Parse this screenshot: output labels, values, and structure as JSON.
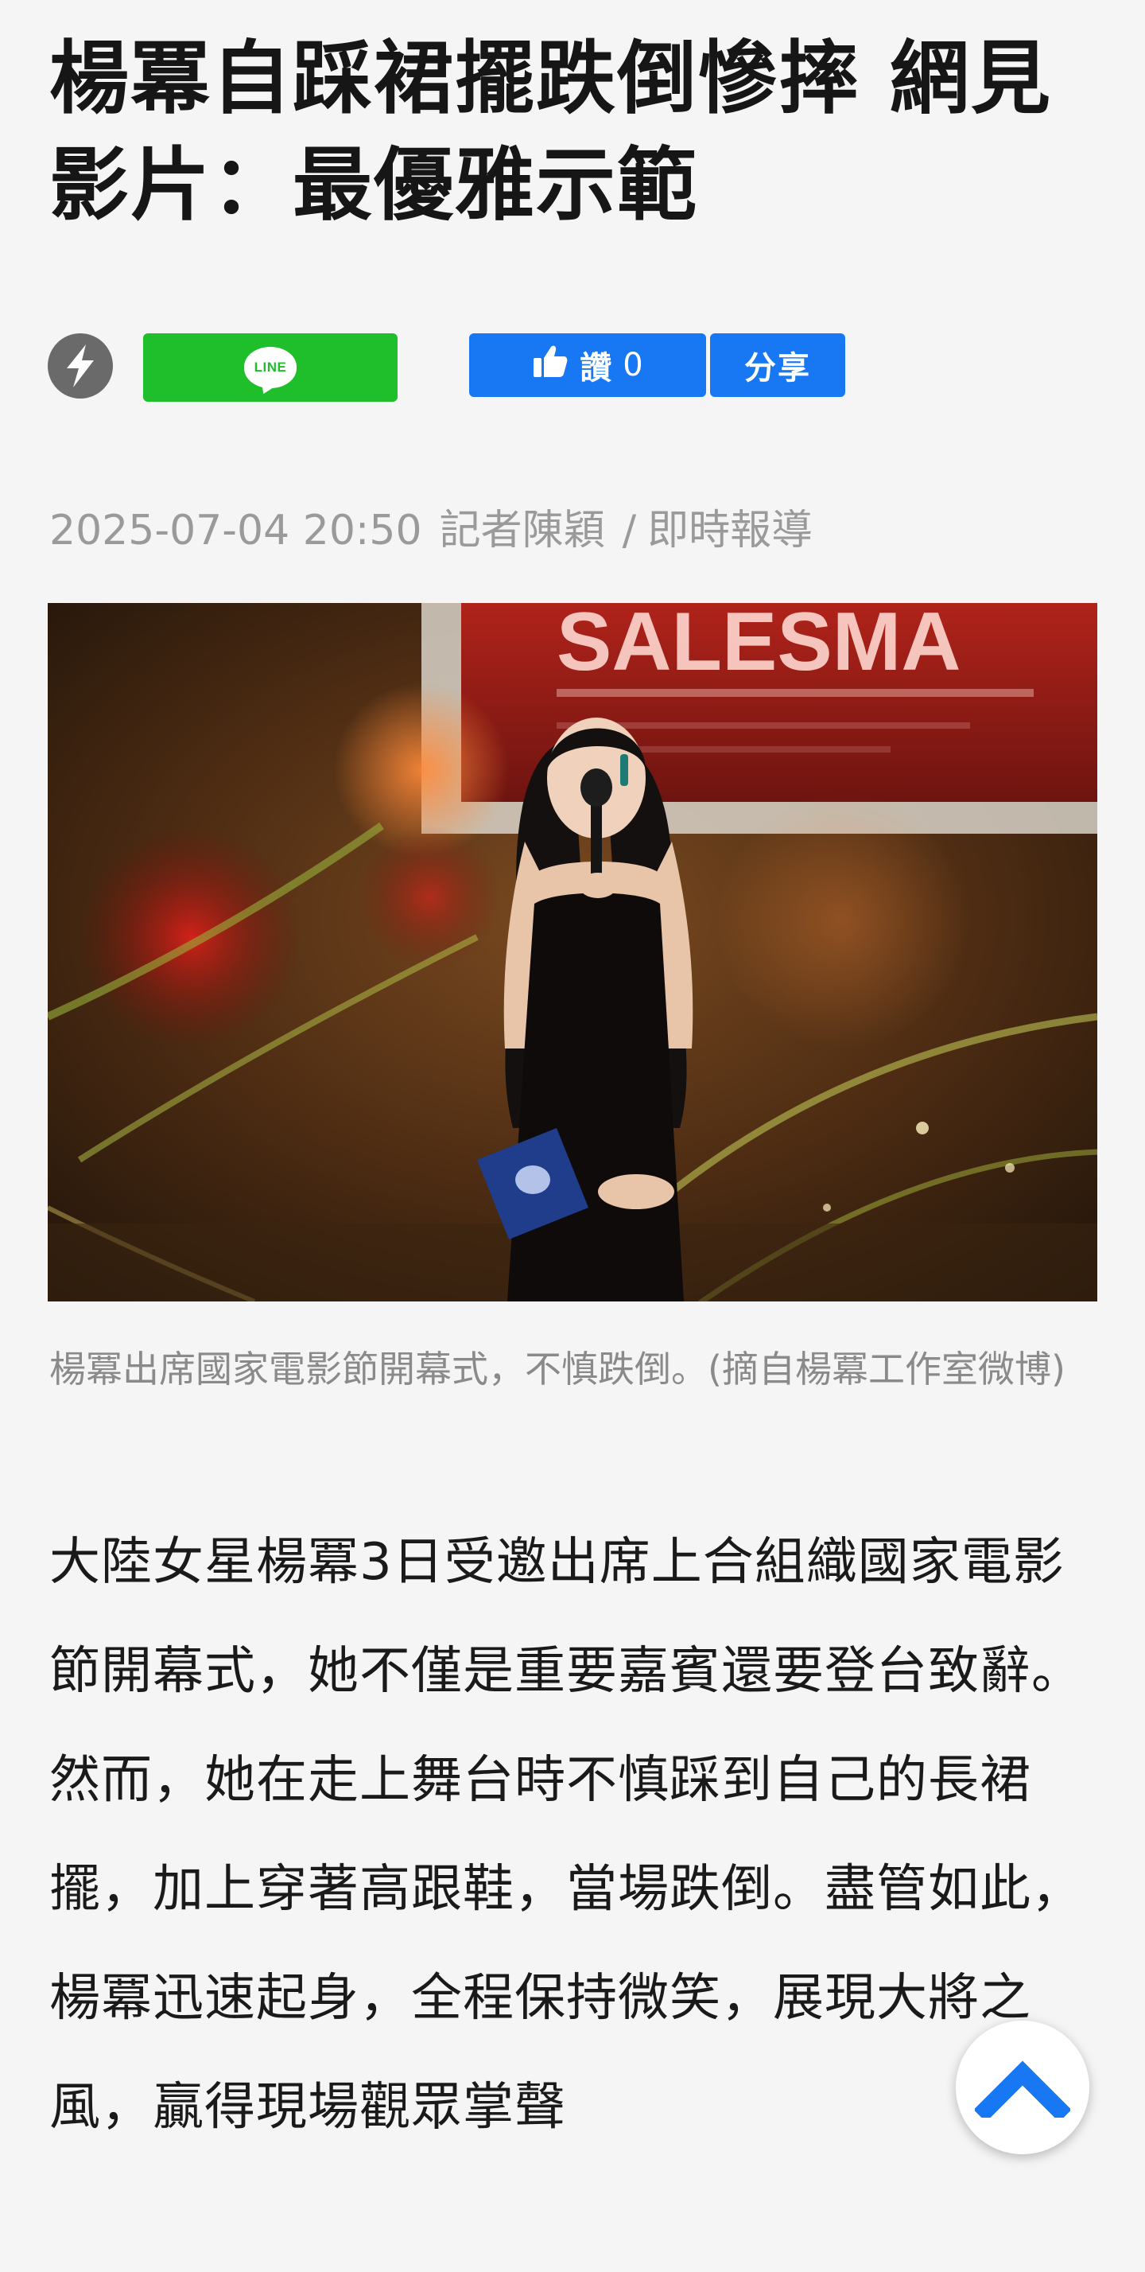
{
  "article": {
    "title": "楊冪自踩裙擺跌倒慘摔 網見影片：最優雅示範",
    "date": "2025-07-04 20:50",
    "reporter": "記者陳穎",
    "separator": "/",
    "section": "即時報導",
    "image_caption": "楊冪出席國家電影節開幕式，不慎跌倒。(摘自楊冪工作室微博)",
    "image_backdrop_text": "SALESMA",
    "body": "大陸女星楊冪3日受邀出席上合組織國家電影節開幕式，她不僅是重要嘉賓還要登台致辭。然而，她在走上舞台時不慎踩到自己的長裙擺，加上穿著高跟鞋，當場跌倒。盡管如此，楊冪迅速起身，全程保持微笑，展現大將之風，贏得現場觀眾掌聲"
  },
  "share_bar": {
    "amp_icon": "lightning-bolt-icon",
    "line_label": "LINE",
    "like_label": "讚",
    "like_count": "0",
    "share_label": "分享",
    "colors": {
      "line_green": "#1fbf2b",
      "facebook_blue": "#1877f2",
      "amp_gray": "#6a6a6a"
    }
  },
  "scroll_top": {
    "icon": "chevron-up-icon",
    "color": "#1877f2"
  }
}
